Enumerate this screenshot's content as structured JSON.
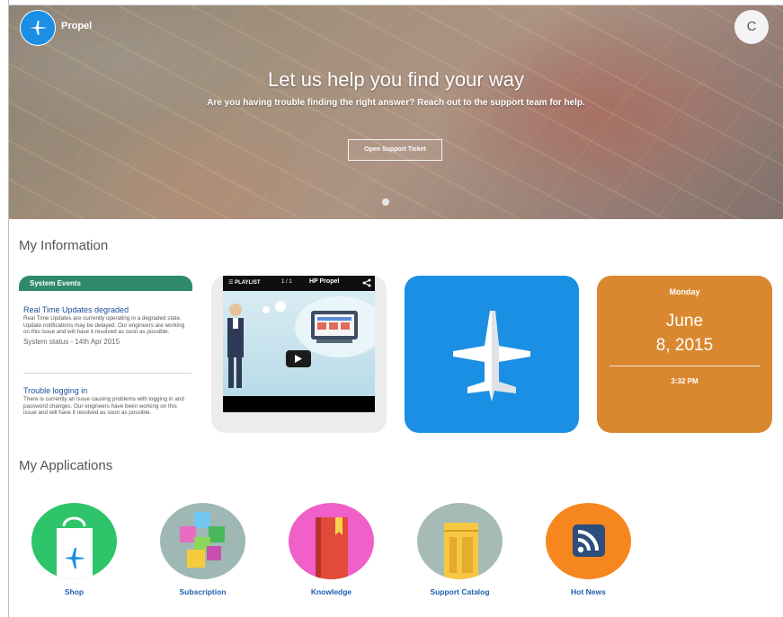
{
  "brand": {
    "name": "Propel",
    "accent": "#1a8fe3"
  },
  "user": {
    "initial": "C"
  },
  "hero": {
    "title": "Let us help you find your way",
    "subtitle": "Are you having trouble finding the right answer? Reach out to the support team for help.",
    "button_label": "Open Support Ticket"
  },
  "sections": {
    "information_title": "My Information",
    "applications_title": "My Applications"
  },
  "system_events": {
    "header": "System Events",
    "header_color": "#2f8a6a",
    "items": [
      {
        "title": "Real Time Updates degraded",
        "body": "Real Time Updates are currently operating in a degraded state. Update notifications may be delayed. Our engineers are working on this issue and will have it resolved as soon as possible.",
        "status": "System status - 14th Apr 2015"
      },
      {
        "title": "Trouble logging in",
        "body": "There is currently an issue causing problems with logging in and password changes. Our engineers have been working on this issue and will have it resolved as soon as possible."
      }
    ]
  },
  "video": {
    "playlist_label": "PLAYLIST",
    "count": "1 / 1",
    "title": "HP Propel"
  },
  "calendar": {
    "day": "Monday",
    "month_day": "June",
    "day_year": "8, 2015",
    "time": "3:32 PM",
    "color": "#d9882f"
  },
  "applications": [
    {
      "label": "Shop",
      "color": "#2ec46a",
      "icon": "shopping-bag-icon"
    },
    {
      "label": "Subscription",
      "color": "#9fb8b4",
      "icon": "cubes-icon"
    },
    {
      "label": "Knowledge",
      "color": "#f060c8",
      "icon": "book-icon"
    },
    {
      "label": "Support Catalog",
      "color": "#a6bab6",
      "icon": "ticket-icon"
    },
    {
      "label": "Hot News",
      "color": "#f6871e",
      "icon": "rss-icon"
    }
  ]
}
